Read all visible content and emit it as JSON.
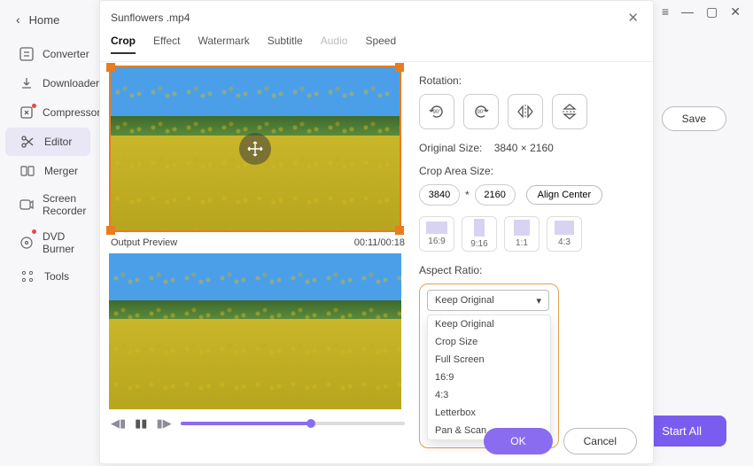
{
  "titlebar": {
    "menu_glyph": "≡",
    "min_glyph": "—",
    "max_glyph": "▢",
    "close_glyph": "✕"
  },
  "sidebar": {
    "home": "Home",
    "items": [
      {
        "label": "Converter"
      },
      {
        "label": "Downloader"
      },
      {
        "label": "Compressor"
      },
      {
        "label": "Editor"
      },
      {
        "label": "Merger"
      },
      {
        "label": "Screen Recorder"
      },
      {
        "label": "DVD Burner"
      },
      {
        "label": "Tools"
      }
    ]
  },
  "main": {
    "save": "Save",
    "start_all": "Start All"
  },
  "modal": {
    "title": "Sunflowers .mp4",
    "tabs": [
      "Crop",
      "Effect",
      "Watermark",
      "Subtitle",
      "Audio",
      "Speed"
    ],
    "preview_label": "Output Preview",
    "time": "00:11/00:18",
    "rotation_label": "Rotation:",
    "rotate_deg": "90°",
    "orig_label": "Original Size:",
    "orig_value": "3840 × 2160",
    "crop_area_label": "Crop Area Size:",
    "crop_w": "3840",
    "crop_sep": "*",
    "crop_h": "2160",
    "align_center": "Align Center",
    "ratio_labels": [
      "16:9",
      "9:16",
      "1:1",
      "4:3"
    ],
    "aspect_label": "Aspect Ratio:",
    "aspect_selected": "Keep Original",
    "aspect_options": [
      "Keep Original",
      "Crop Size",
      "Full Screen",
      "16:9",
      "4:3",
      "Letterbox",
      "Pan & Scan"
    ],
    "ok": "OK",
    "cancel": "Cancel"
  }
}
